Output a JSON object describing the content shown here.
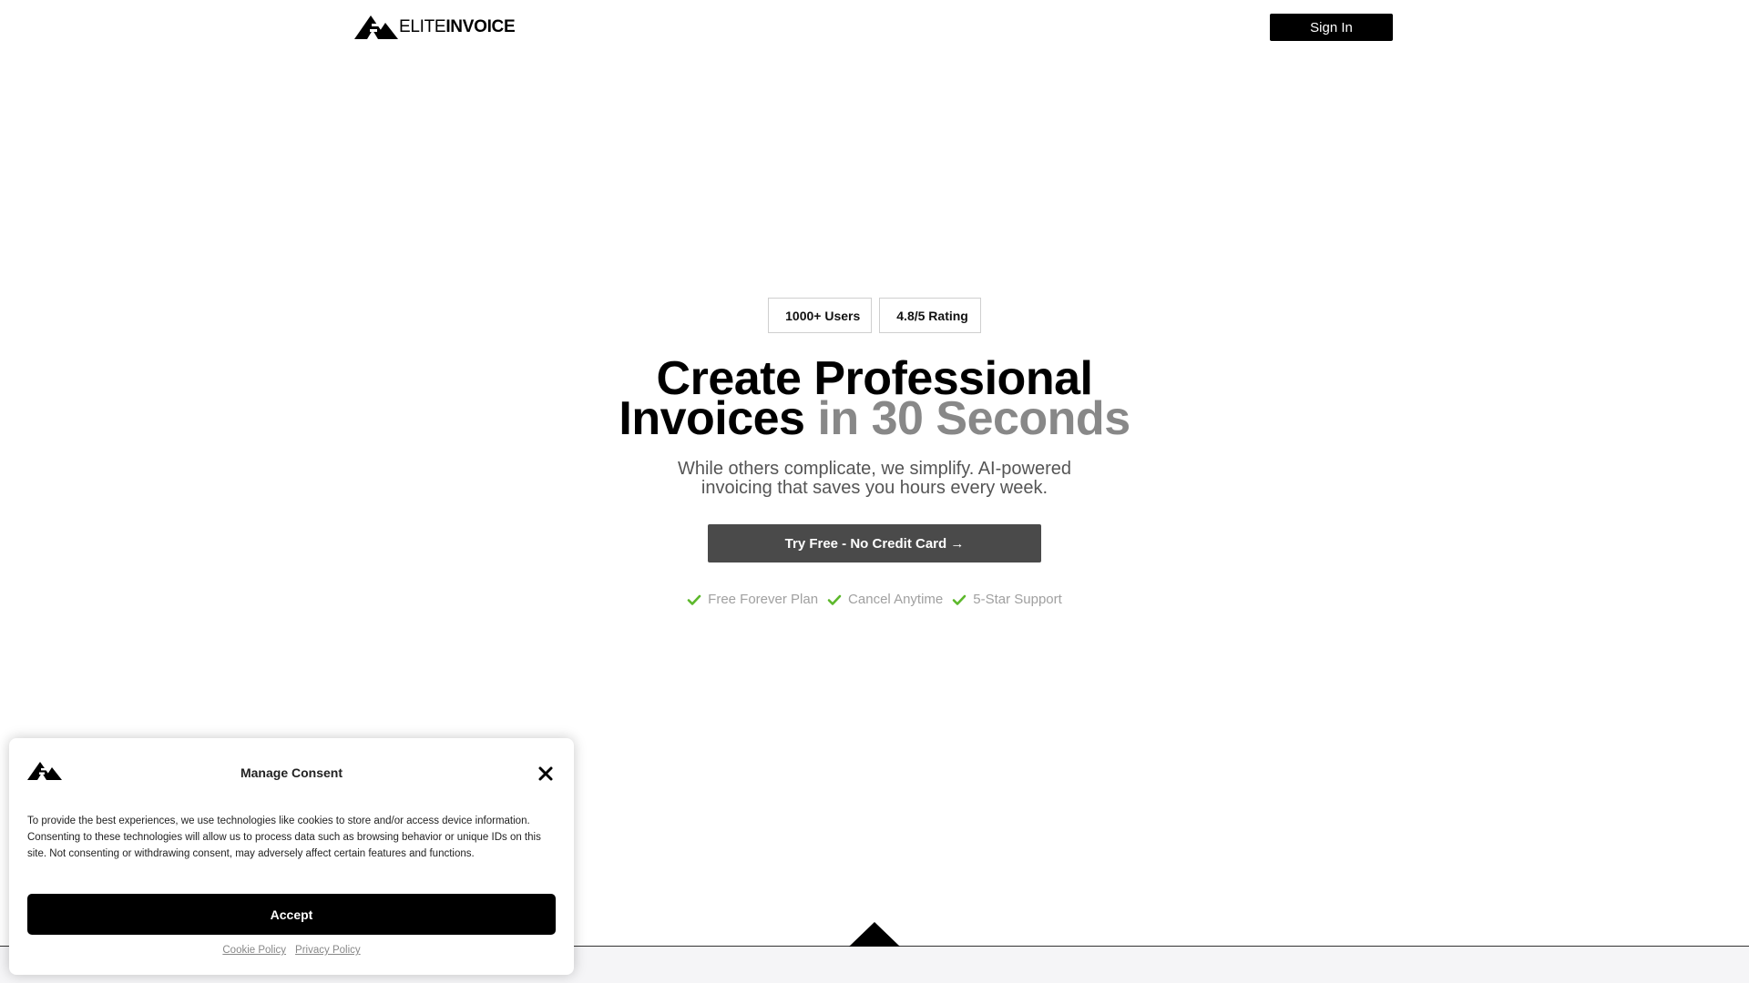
{
  "header": {
    "logo_light": "ELITE",
    "logo_bold": "INVOICE",
    "signin_label": "Sign In"
  },
  "hero": {
    "badges": [
      "1000+ Users",
      "4.8/5 Rating"
    ],
    "title_line1": "Create Professional",
    "title_line2_dark": "Invoices",
    "title_line2_grey": "in 30 Seconds",
    "subtitle": "While others complicate, we simplify. AI-powered invoicing that saves you hours every week.",
    "cta_label": "Try Free - No Credit Card →",
    "features": [
      "Free Forever Plan",
      "Cancel Anytime",
      "5-Star Support"
    ]
  },
  "consent": {
    "title": "Manage Consent",
    "body": "To provide the best experiences, we use technologies like cookies to store and/or access device information. Consenting to these technologies will allow us to process data such as browsing behavior or unique IDs on this site. Not consenting or withdrawing consent, may adversely affect certain features and functions.",
    "accept_label": "Accept",
    "cookie_policy": "Cookie Policy",
    "privacy_policy": "Privacy Policy"
  },
  "colors": {
    "brand": "#000000",
    "cta": "#4a4a4a",
    "grey_accent": "#888888",
    "check": "#5cb82b"
  },
  "icons": {
    "logo": "elite-invoice-logo-icon",
    "check": "check-icon",
    "close": "close-icon"
  }
}
